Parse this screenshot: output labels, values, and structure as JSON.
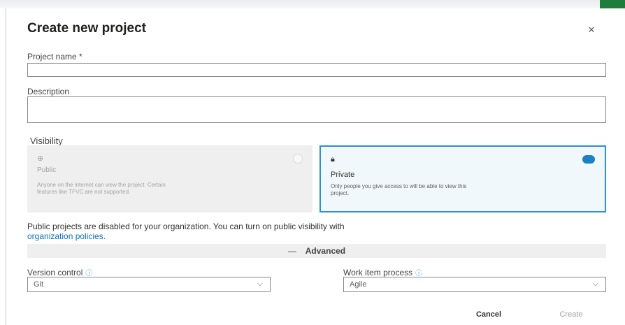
{
  "dialog": {
    "title": "Create new project",
    "close_icon": "close-icon"
  },
  "form": {
    "project_name_label": "Project name *",
    "project_name_value": "",
    "description_label": "Description",
    "description_value": "",
    "visibility_label": "Visibility"
  },
  "visibility_options": [
    {
      "title": "Public",
      "description": "Anyone on the internet can view the project. Certain features like TFVC are not supported.",
      "icon": "globe-icon",
      "selected": false,
      "disabled": true
    },
    {
      "title": "Private",
      "description": "Only people you give access to will be able to view this project.",
      "icon": "lock-icon",
      "selected": true,
      "disabled": false
    }
  ],
  "notice": {
    "text": "Public projects are disabled for your organization. You can turn on public visibility with",
    "link_text": "organization policies."
  },
  "advanced": {
    "toggle_symbol": "—",
    "label": "Advanced",
    "version_control": {
      "label": "Version control",
      "value": "Git"
    },
    "work_item_process": {
      "label": "Work item process",
      "value": "Agile"
    }
  },
  "buttons": {
    "cancel": "Cancel",
    "create": "Create"
  },
  "colors": {
    "accent": "#2f8fd1",
    "link": "#0a72c7",
    "topbar_accent": "#1e7d3a"
  }
}
